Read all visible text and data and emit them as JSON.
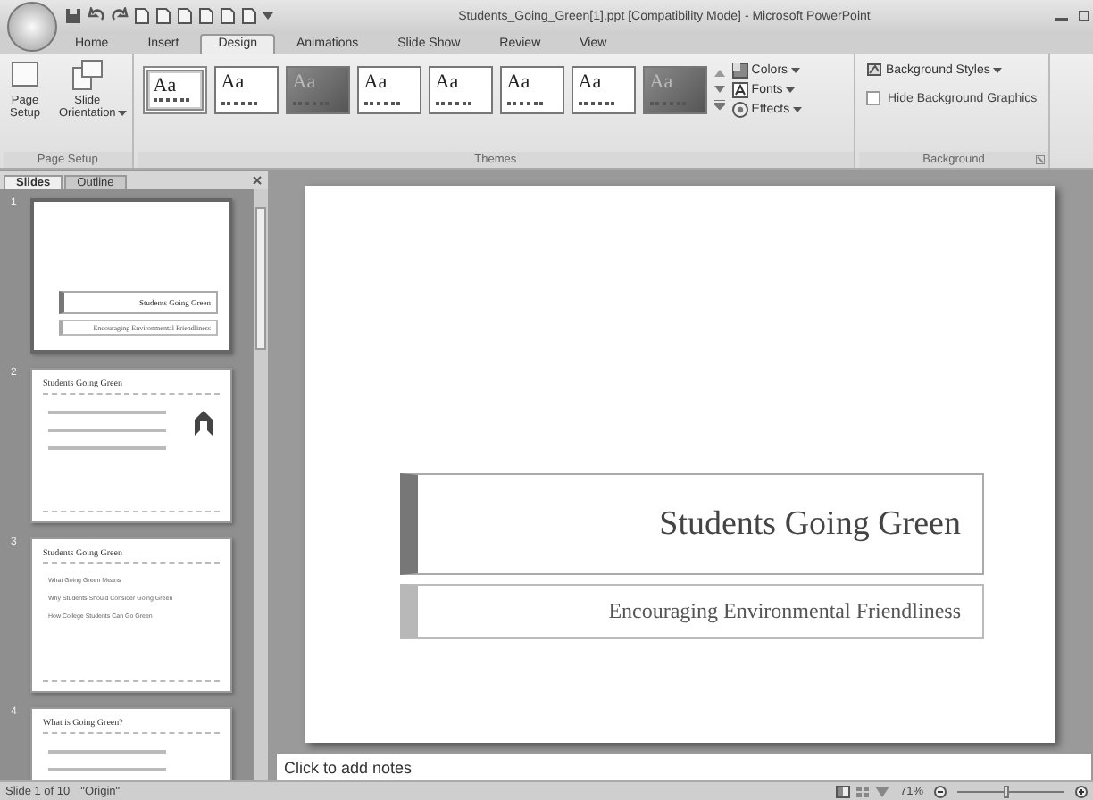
{
  "window": {
    "title": "Students_Going_Green[1].ppt [Compatibility Mode] - Microsoft PowerPoint"
  },
  "ribbon_tabs": [
    {
      "label": "Home",
      "selected": false
    },
    {
      "label": "Insert",
      "selected": false
    },
    {
      "label": "Design",
      "selected": true
    },
    {
      "label": "Animations",
      "selected": false
    },
    {
      "label": "Slide Show",
      "selected": false
    },
    {
      "label": "Review",
      "selected": false
    },
    {
      "label": "View",
      "selected": false
    }
  ],
  "page_setup": {
    "buttons": [
      {
        "label": "Page Setup",
        "dropdown": false
      },
      {
        "label": "Slide Orientation",
        "dropdown": true
      }
    ],
    "group_label": "Page Setup"
  },
  "themes": {
    "items": [
      {
        "label": "Aa",
        "dark": false,
        "selected": true
      },
      {
        "label": "Aa",
        "dark": false,
        "selected": false
      },
      {
        "label": "Aa",
        "dark": true,
        "selected": false
      },
      {
        "label": "Aa",
        "dark": false,
        "selected": false
      },
      {
        "label": "Aa",
        "dark": false,
        "selected": false
      },
      {
        "label": "Aa",
        "dark": false,
        "selected": false
      },
      {
        "label": "Aa",
        "dark": false,
        "selected": false
      },
      {
        "label": "Aa",
        "dark": true,
        "selected": false
      }
    ],
    "options": [
      "Colors",
      "Fonts",
      "Effects"
    ],
    "group_label": "Themes"
  },
  "background": {
    "styles_label": "Background Styles",
    "hide_graphics": {
      "label": "Hide Background Graphics",
      "checked": false
    },
    "group_label": "Background"
  },
  "panel_tabs": [
    {
      "label": "Slides",
      "selected": true
    },
    {
      "label": "Outline",
      "selected": false
    }
  ],
  "slides": [
    {
      "number": "1",
      "kind": "title",
      "selected": true,
      "title": "Students Going Green",
      "subtitle": "Encouraging Environmental Friendliness"
    },
    {
      "number": "2",
      "kind": "bullets",
      "selected": false,
      "title": "Students Going Green",
      "emblem": true
    },
    {
      "number": "3",
      "kind": "bullets",
      "selected": false,
      "title": "Students Going Green",
      "bullets": [
        "What Going Green Means",
        "Why Students Should Consider Going Green",
        "How College Students Can Go Green"
      ],
      "emblem": false
    },
    {
      "number": "4",
      "kind": "bullets",
      "selected": false,
      "title": "What is Going Green?",
      "emblem": false
    }
  ],
  "current_slide": {
    "title": "Students Going Green",
    "subtitle": "Encouraging Environmental Friendliness"
  },
  "notes": {
    "placeholder": "Click to add notes"
  },
  "status_bar": {
    "slide_position": "Slide 1 of 10",
    "theme": "\"Origin\"",
    "zoom": "71%",
    "zoom_slider": {
      "level": 0.45
    }
  }
}
